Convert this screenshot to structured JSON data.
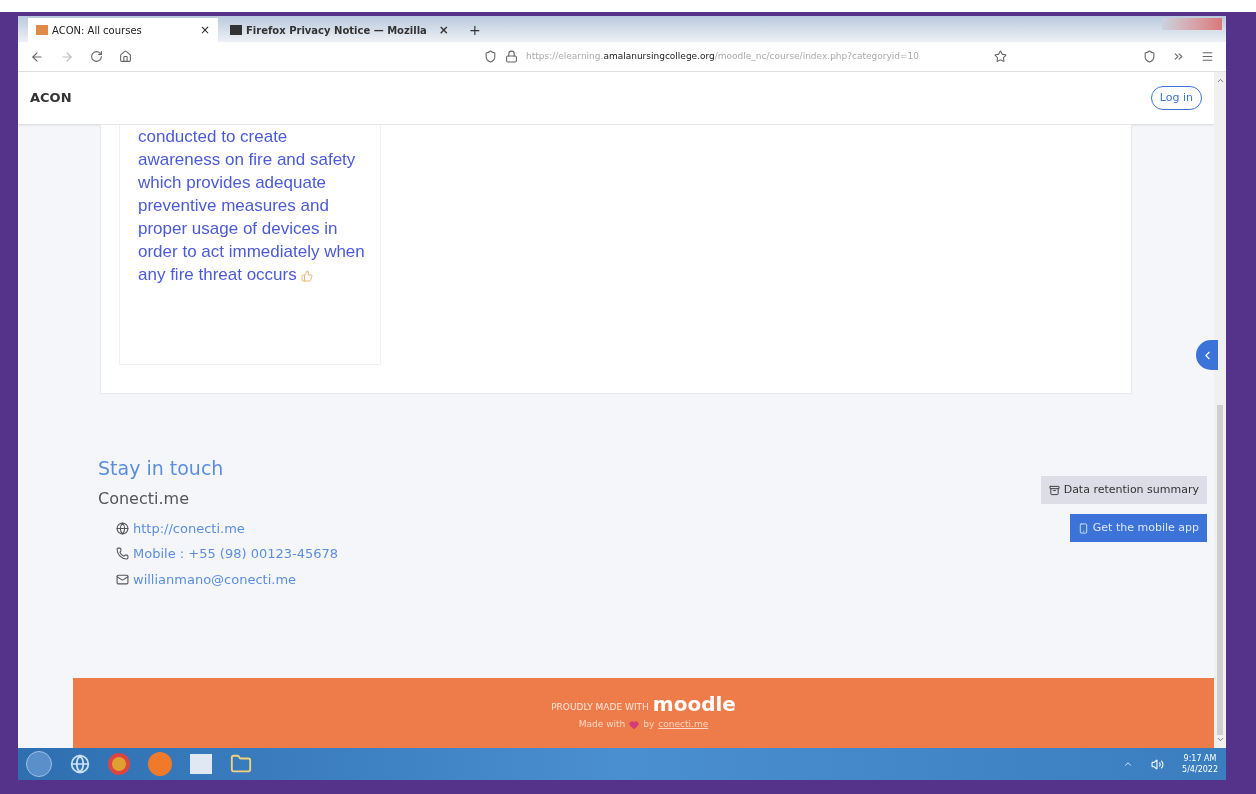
{
  "browser": {
    "tabs": [
      {
        "title": "ACON: All courses",
        "close": "×",
        "selected": true
      },
      {
        "title": "Firefox Privacy Notice — Mozilla",
        "close": "×",
        "selected": false
      }
    ],
    "new_tab": "+",
    "url": {
      "prefix": "https://elearning.",
      "domain": "amalanursingcollege.org",
      "path": "/moodle_nc/course/index.php?categoryid=10"
    }
  },
  "navbar": {
    "brand": "ACON",
    "login": "Log in"
  },
  "course_card": {
    "description": "conducted to create awareness on fire and safety which provides adequate preventive measures and proper usage of devices in order to act immediately when any fire threat occurs"
  },
  "contact": {
    "heading": "Stay in touch",
    "company": "Conecti.me",
    "items": [
      {
        "kind": "web",
        "text": "http://conecti.me"
      },
      {
        "kind": "phone",
        "text": "Mobile : +55 (98) 00123-45678"
      },
      {
        "kind": "email",
        "text": "willianmano@conecti.me"
      }
    ]
  },
  "buttons": [
    {
      "kind": "secondary",
      "label": "Data retention summary"
    },
    {
      "kind": "primary",
      "label": "Get the mobile app"
    }
  ],
  "footer_bar": {
    "made_with": "PROUDLY MADE WITH",
    "logo": "moodle",
    "credit_prefix": "Made with",
    "credit_by": "by",
    "credit_link": "conecti.me"
  },
  "taskbar": {
    "time": "9:17 AM",
    "date": "5/4/2022"
  }
}
